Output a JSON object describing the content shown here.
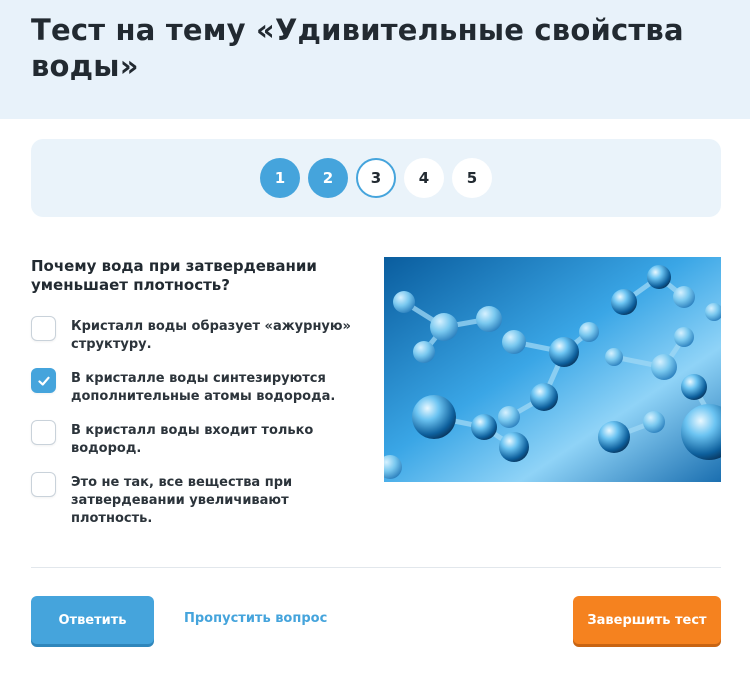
{
  "header": {
    "title": "Тест на тему «Удивительные свойства воды»"
  },
  "pager": {
    "pages": [
      {
        "label": "1",
        "state": "done"
      },
      {
        "label": "2",
        "state": "done"
      },
      {
        "label": "3",
        "state": "current"
      },
      {
        "label": "4",
        "state": "todo"
      },
      {
        "label": "5",
        "state": "todo"
      }
    ]
  },
  "question": {
    "text": "Почему вода при затвердевании уменьшает плотность?",
    "options": [
      {
        "label": "Кристалл воды образует «ажурную» структуру.",
        "checked": false
      },
      {
        "label": "В кристалле воды синтезируются дополнительные атомы водорода.",
        "checked": true
      },
      {
        "label": "В кристалл воды входит только водород.",
        "checked": false
      },
      {
        "label": "Это не так, все вещества при затвердевании увеличивают плотность.",
        "checked": false
      }
    ],
    "image_icon": "water-molecules-image"
  },
  "actions": {
    "answer_label": "Ответить",
    "skip_label": "Пропустить вопрос",
    "finish_label": "Завершить тест"
  },
  "colors": {
    "accent": "#45a4dc",
    "finish": "#f5821f",
    "header_bg": "#e8f2fa"
  }
}
